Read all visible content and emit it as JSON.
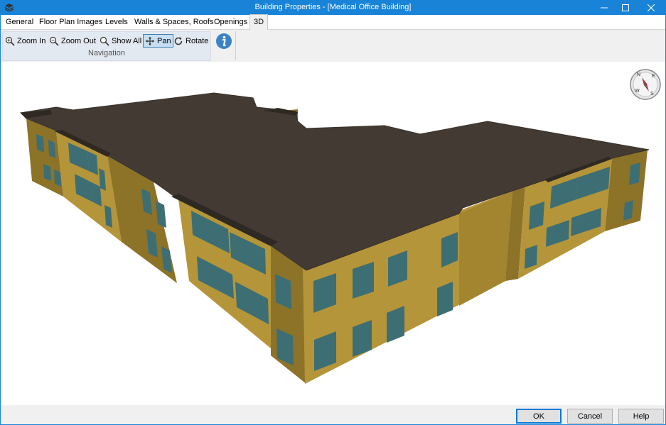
{
  "window": {
    "title": "Building Properties - [Medical Office Building]",
    "accent": "#1883d7"
  },
  "titlebar": {
    "app_icon": "layers-icon",
    "minimize_icon": "minimize-icon",
    "maximize_icon": "maximize-icon",
    "close_icon": "close-icon"
  },
  "tabs": [
    {
      "label": "General"
    },
    {
      "label": "Floor Plan Images"
    },
    {
      "label": "Levels"
    },
    {
      "label": "Walls & Spaces, Roofs"
    },
    {
      "label": "Openings"
    },
    {
      "label": "3D",
      "active": true
    }
  ],
  "ribbon": {
    "navigation": {
      "group_label": "Navigation",
      "buttons": [
        {
          "label": "Zoom In",
          "icon": "zoom-in-icon"
        },
        {
          "label": "Zoom Out",
          "icon": "zoom-out-icon"
        },
        {
          "label": "Show All",
          "icon": "magnifier-icon"
        },
        {
          "label": "Pan",
          "icon": "pan-icon",
          "active": true
        },
        {
          "label": "Rotate",
          "icon": "rotate-icon"
        }
      ]
    },
    "info_icon": "info-icon"
  },
  "viewport": {
    "compass": {
      "n": "N",
      "e": "E",
      "s": "S",
      "w": "W"
    },
    "colors": {
      "roof": "#423a33",
      "wall_light": "#b59539",
      "wall_dark": "#8d7328",
      "window": "#3d6e73"
    }
  },
  "footer": {
    "ok": "OK",
    "cancel": "Cancel",
    "help": "Help"
  }
}
